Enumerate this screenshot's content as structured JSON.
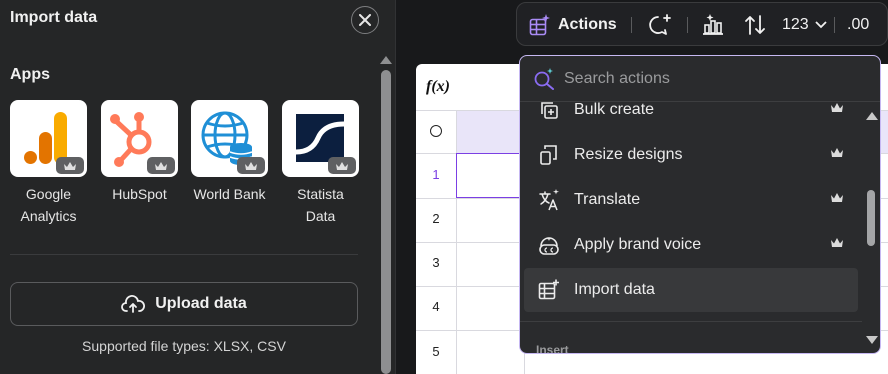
{
  "panel": {
    "title": "Import data",
    "apps_heading": "Apps",
    "apps": [
      {
        "label_line1": "Google",
        "label_line2": "Analytics"
      },
      {
        "label_line1": "HubSpot",
        "label_line2": ""
      },
      {
        "label_line1": "World Bank",
        "label_line2": ""
      },
      {
        "label_line1": "Statista",
        "label_line2": "Data"
      }
    ],
    "upload_label": "Upload data",
    "supported_text": "Supported file types: XLSX, CSV"
  },
  "sheet": {
    "formula_label": "f(x)",
    "rows": [
      "1",
      "2",
      "3",
      "4",
      "5"
    ],
    "active_row": "1"
  },
  "toolbar": {
    "actions_label": "Actions",
    "number_format": "123",
    "decimal_label": ".00"
  },
  "actions_menu": {
    "search_placeholder": "Search actions",
    "items": [
      {
        "label": "Bulk create",
        "icon": "bulk-create-icon",
        "premium": true
      },
      {
        "label": "Resize designs",
        "icon": "resize-icon",
        "premium": true
      },
      {
        "label": "Translate",
        "icon": "translate-icon",
        "premium": true
      },
      {
        "label": "Apply brand voice",
        "icon": "brand-voice-icon",
        "premium": true
      },
      {
        "label": "Import data",
        "icon": "import-data-icon",
        "premium": false
      }
    ],
    "next_section": "Insert"
  },
  "colors": {
    "accent_purple": "#7b3fe4",
    "dropdown_border": "#c6b8f2"
  }
}
